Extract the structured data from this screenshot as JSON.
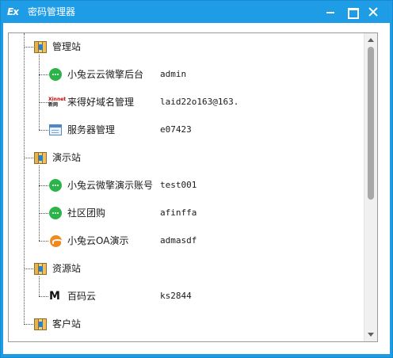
{
  "window": {
    "title": "密码管理器",
    "app_icon_text": "Ex",
    "accent_color": "#1e9de6"
  },
  "tree": {
    "groups": [
      {
        "label": "管理站",
        "icon": "book-icon",
        "children": [
          {
            "label": "小兔云云微擎后台",
            "value": "admin",
            "icon": "wechat-icon"
          },
          {
            "label": "来得好域名管理",
            "value": "laid22o163@163.",
            "icon": "xinnet-icon"
          },
          {
            "label": "服务器管理",
            "value": "e07423",
            "icon": "server-icon"
          }
        ]
      },
      {
        "label": "演示站",
        "icon": "book-icon",
        "children": [
          {
            "label": "小兔云微擎演示账号",
            "value": "test001",
            "icon": "wechat-icon"
          },
          {
            "label": "社区团购",
            "value": "afinffa",
            "icon": "wechat-icon"
          },
          {
            "label": "小兔云OA演示",
            "value": "admasdf",
            "icon": "oa-icon"
          }
        ]
      },
      {
        "label": "资源站",
        "icon": "book-icon",
        "children": [
          {
            "label": "百码云",
            "value": "ks2844",
            "icon": "m-logo-icon"
          }
        ]
      },
      {
        "label": "客户站",
        "icon": "book-icon",
        "children": []
      }
    ],
    "xinnet_icon_text": [
      "Xinnet",
      "新网"
    ]
  }
}
